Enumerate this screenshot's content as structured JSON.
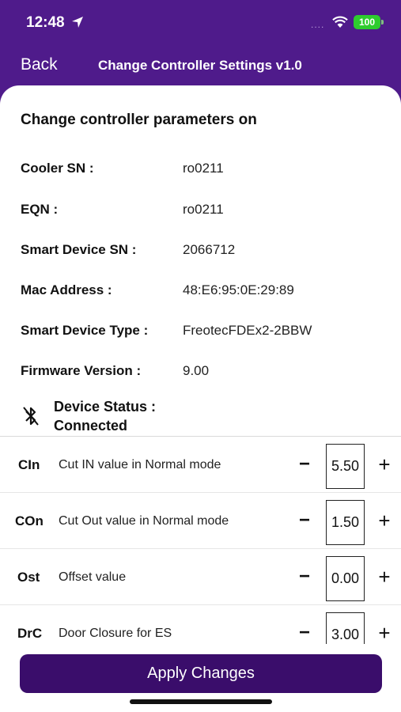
{
  "status_bar": {
    "time": "12:48",
    "signal": "....",
    "battery": "100"
  },
  "nav": {
    "back_label": "Back",
    "title": "Change Controller Settings v1.0"
  },
  "heading": "Change controller parameters on",
  "info": [
    {
      "label": "Cooler SN :",
      "value": "ro0211"
    },
    {
      "label": "EQN :",
      "value": "ro0211"
    },
    {
      "label": "Smart Device SN :",
      "value": "2066712"
    },
    {
      "label": "Mac Address :",
      "value": "48:E6:95:0E:29:89"
    },
    {
      "label": "Smart Device Type :",
      "value": "FreotecFDEx2-2BBW"
    },
    {
      "label": "Firmware Version :",
      "value": "9.00"
    }
  ],
  "device_status": {
    "label": "Device Status :",
    "value": "Connected"
  },
  "params": [
    {
      "code": "CIn",
      "desc": "Cut IN value in Normal mode",
      "value": "5.50",
      "minus": "−",
      "plus": "+"
    },
    {
      "code": "COn",
      "desc": "Cut Out value in Normal mode",
      "value": "1.50",
      "minus": "−",
      "plus": "+"
    },
    {
      "code": "Ost",
      "desc": "Offset value",
      "value": "0.00",
      "minus": "−",
      "plus": "+"
    },
    {
      "code": "DrC",
      "desc": "Door Closure for ES",
      "value": "3.00",
      "minus": "−",
      "plus": "+"
    }
  ],
  "apply_label": "Apply Changes",
  "colors": {
    "brand": "#4f1b8b",
    "button": "#3a0d6b",
    "battery": "#2ecc2e"
  }
}
